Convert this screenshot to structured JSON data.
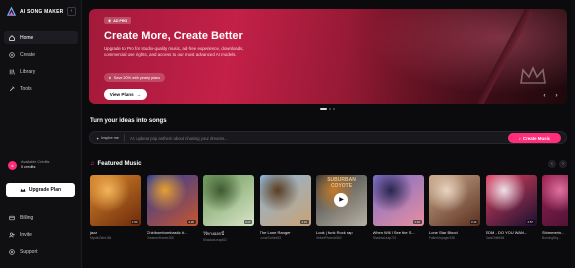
{
  "app": {
    "name": "AI SONG MAKER",
    "collapse_icon": "chevron-left-icon"
  },
  "sidebar": {
    "nav": [
      {
        "label": "Home",
        "icon": "home-icon",
        "active": true
      },
      {
        "label": "Create",
        "icon": "plus-circle-icon",
        "active": false
      },
      {
        "label": "Library",
        "icon": "library-icon",
        "active": false
      },
      {
        "label": "Tools",
        "icon": "tools-icon",
        "active": false
      }
    ],
    "credits": {
      "label": "Available Credits",
      "value": "0 credits"
    },
    "upgrade_label": "Upgrade Plan",
    "bottom_nav": [
      {
        "label": "Billing",
        "icon": "billing-icon"
      },
      {
        "label": "Invite",
        "icon": "invite-icon"
      },
      {
        "label": "Support",
        "icon": "support-icon"
      }
    ]
  },
  "banner": {
    "tag": "AD PRO",
    "title": "Create More, Create Better",
    "description": "Upgrade to Pro for studio-quality music, ad-free experience, downloads, commercial use rights, and access to our most advanced AI models.",
    "save_pill": "Save 20% with yearly plans",
    "cta": "View Plans",
    "accent": "#c42048"
  },
  "prompt": {
    "section_title": "Turn your ideas into songs",
    "inspire_label": "Inspire me",
    "placeholder": "AI: upbeat pop anthem about chasing your dreams...",
    "create_label": "Create Music",
    "accent": "#ff2d7a"
  },
  "featured": {
    "title": "Featured Music",
    "cards": [
      {
        "title": "jazz",
        "artist": "MysticOtter184",
        "duration": "1:53",
        "colors": [
          "#d9862a",
          "#6b2a0c",
          "#f2b45a"
        ]
      },
      {
        "title": "Chiribombombastic #...",
        "artist": "DreamerHamm185",
        "duration": "2:20",
        "colors": [
          "#2a3d9a",
          "#c8552e",
          "#e8a030"
        ]
      },
      {
        "title": "ไร้ทางออกนี้",
        "artist": "ShadowLeap402",
        "duration": "0:20",
        "colors": [
          "#6f9a5c",
          "#d7e4c6",
          "#3d5a2f"
        ]
      },
      {
        "title": "The Lone Ranger",
        "artist": "LunarTurtle463",
        "duration": "2:31",
        "colors": [
          "#8fb7d8",
          "#c9a276",
          "#5a3d22"
        ]
      },
      {
        "title": "Look | funk Rock rap",
        "artist": "VelvetPhoenix563",
        "duration": "",
        "colors": [
          "#3a3a3a",
          "#b8b2a4",
          "#c47a2a"
        ],
        "playing": true,
        "cover_text": "SUBURBAN COYOTE"
      },
      {
        "title": "When Will I See the S...",
        "artist": "ShadowLeap721",
        "duration": "2:16",
        "colors": [
          "#7a6ec9",
          "#e78fa0",
          "#2a2650"
        ]
      },
      {
        "title": "Lone Star Blood",
        "artist": "FallenVoyager338",
        "duration": "3:14",
        "colors": [
          "#c9a78a",
          "#5a3020",
          "#e8d4c0"
        ]
      },
      {
        "title": "EDM - DO YOU WAN...",
        "artist": "DarkOrbit654",
        "duration": "2:57",
        "colors": [
          "#e24060",
          "#1a1030",
          "#f0e0e8"
        ]
      },
      {
        "title": "Shimmerin...",
        "artist": "BurningSky...",
        "duration": "",
        "colors": [
          "#a02050",
          "#3a1030",
          "#e070a0"
        ]
      }
    ]
  }
}
